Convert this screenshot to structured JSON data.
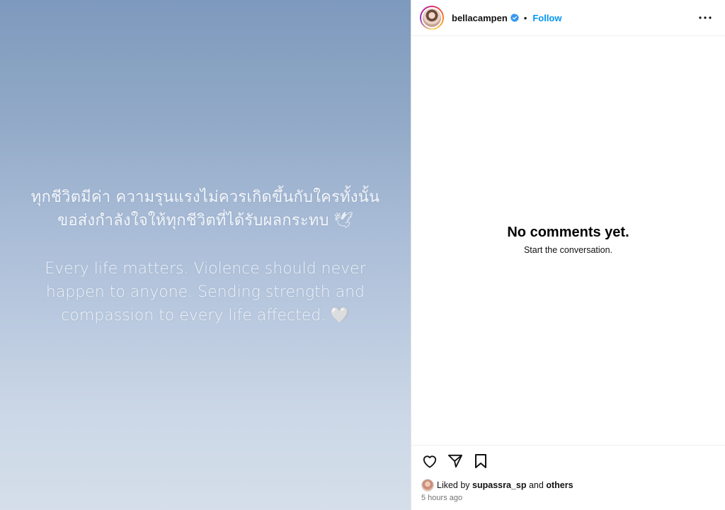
{
  "post": {
    "thai_lines": [
      "ทุกชีวิตมีค่า ความรุนแรงไม่ควรเกิดขึ้นกับใครทั้งนั้น",
      "ขอส่งกำลังใจให้ทุกชีวิตที่ได้รับผลกระทบ"
    ],
    "dove_emoji": "🕊",
    "english_lines": [
      "Every life matters. Violence should never",
      "happen to anyone. Sending strength and",
      "compassion to every life affected."
    ],
    "heart_emoji": "🤍",
    "gradient_colors": [
      "#7d99bd",
      "#d5deea"
    ]
  },
  "header": {
    "username": "bellacampen",
    "verified_icon": "verified-badge-icon",
    "separator": "•",
    "follow_label": "Follow",
    "more_icon": "more-options-icon"
  },
  "comments": {
    "empty_title": "No comments yet.",
    "empty_subtitle": "Start the conversation."
  },
  "actions": {
    "like_icon": "heart-icon",
    "share_icon": "send-icon",
    "save_icon": "bookmark-icon"
  },
  "likes": {
    "prefix": "Liked by",
    "user": "supassra_sp",
    "connector": "and",
    "others": "others"
  },
  "time_ago": "5 hours ago",
  "colors": {
    "accent": "#0095f6",
    "verified": "#3897f0",
    "muted_text": "#737373"
  }
}
